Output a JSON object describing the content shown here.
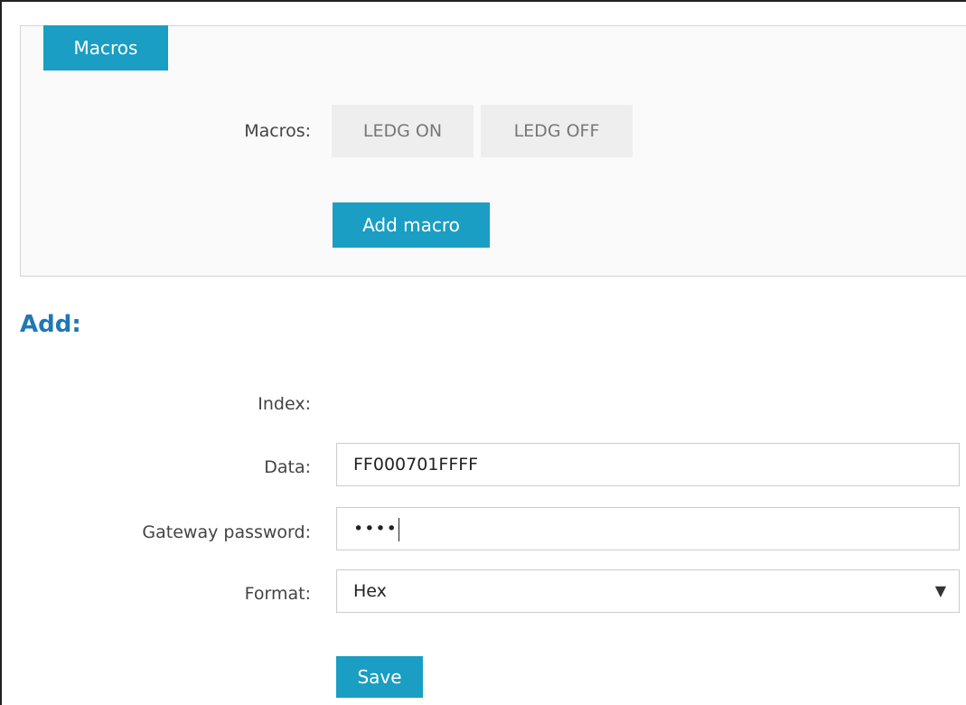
{
  "macros_panel": {
    "tab_label": "Macros",
    "macros_label": "Macros:",
    "macro_buttons": [
      "LEDG ON",
      "LEDG OFF"
    ],
    "add_macro_label": "Add macro"
  },
  "add_section": {
    "title": "Add:",
    "index_label": "Index:",
    "data_label": "Data:",
    "data_value": "FF000701FFFF",
    "password_label": "Gateway password:",
    "password_value": "••••",
    "format_label": "Format:",
    "format_value": "Hex",
    "save_label": "Save"
  },
  "colors": {
    "accent": "#1a9ec3",
    "title": "#1f78b5"
  }
}
